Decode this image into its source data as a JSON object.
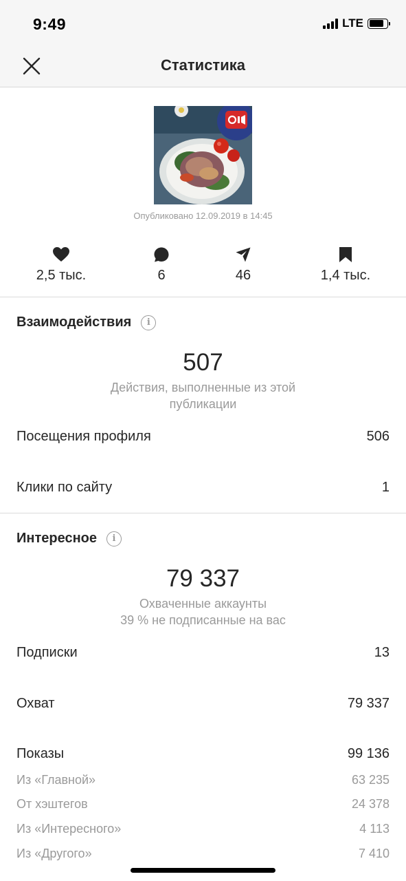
{
  "status_bar": {
    "time": "9:49",
    "network": "LTE"
  },
  "header": {
    "title": "Статистика",
    "close_icon": "close-icon"
  },
  "post": {
    "published": "Опубликовано 12.09.2019 в 14:45",
    "video_badge_icon": "igtv-icon"
  },
  "metrics": [
    {
      "icon": "heart-icon",
      "value": "2,5 тыс."
    },
    {
      "icon": "comment-icon",
      "value": "6"
    },
    {
      "icon": "share-icon",
      "value": "46"
    },
    {
      "icon": "bookmark-icon",
      "value": "1,4 тыс."
    }
  ],
  "interactions": {
    "title": "Взаимодействия",
    "total": "507",
    "caption": "Действия, выполненные из этой публикации",
    "rows": [
      {
        "label": "Посещения профиля",
        "value": "506"
      },
      {
        "label": "Клики по сайту",
        "value": "1"
      }
    ]
  },
  "discovery": {
    "title": "Интересное",
    "total": "79 337",
    "caption_1": "Охваченные аккаунты",
    "caption_2": "39 % не подписанные на вас",
    "rows": [
      {
        "label": "Подписки",
        "value": "13"
      },
      {
        "label": "Охват",
        "value": "79 337"
      },
      {
        "label": "Показы",
        "value": "99 136"
      }
    ],
    "impressions_breakdown": [
      {
        "label": "Из «Главной»",
        "value": "63 235"
      },
      {
        "label": "От хэштегов",
        "value": "24 378"
      },
      {
        "label": "Из «Интересного»",
        "value": "4 113"
      },
      {
        "label": "Из «Другого»",
        "value": "7 410"
      }
    ]
  },
  "colors": {
    "text": "#262626",
    "muted": "#9a9a9a",
    "header_bg": "#f6f6f6",
    "divider": "#dbdbdb"
  }
}
